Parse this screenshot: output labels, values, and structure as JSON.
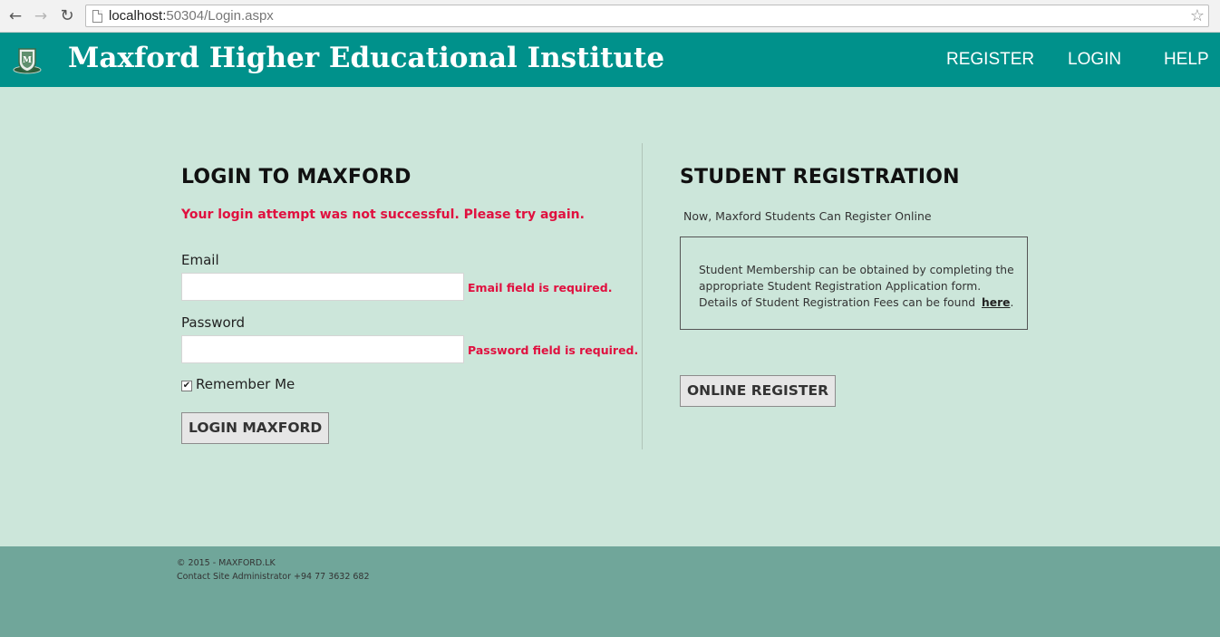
{
  "browser": {
    "url_host": "localhost:",
    "url_path": "50304/Login.aspx"
  },
  "header": {
    "title": "Maxford Higher Educational Institute",
    "menu": [
      "REGISTER",
      "LOGIN",
      "HELP"
    ],
    "color": "#00918b"
  },
  "login": {
    "title": "LOGIN TO MAXFORD",
    "failure_message": "Your login attempt was not successful. Please try again.",
    "email_label": "Email",
    "email_value": "",
    "email_error": "Email field is required.",
    "password_label": "Password",
    "password_value": "",
    "password_error": "Password field is required.",
    "remember_label": "Remember Me",
    "remember_checked": true,
    "button_label": "LOGIN MAXFORD"
  },
  "registration": {
    "title": "STUDENT REGISTRATION",
    "subtitle": "Now, Maxford Students Can Register Online",
    "info_line1": "Student Membership can be obtained by completing the",
    "info_line2": "appropriate Student Registration Application form.",
    "info_line3": "Details of Student Registration Fees can be found",
    "here_link": "here",
    "info_end": ".",
    "button_label": "ONLINE REGISTER"
  },
  "footer": {
    "copyright": "© 2015 - MAXFORD.LK",
    "contact": "Contact Site Administrator +94 77 3632 682"
  },
  "colors": {
    "page_bg": "#cce6da",
    "footer_bg": "#70a69a",
    "error": "#e0103f"
  }
}
